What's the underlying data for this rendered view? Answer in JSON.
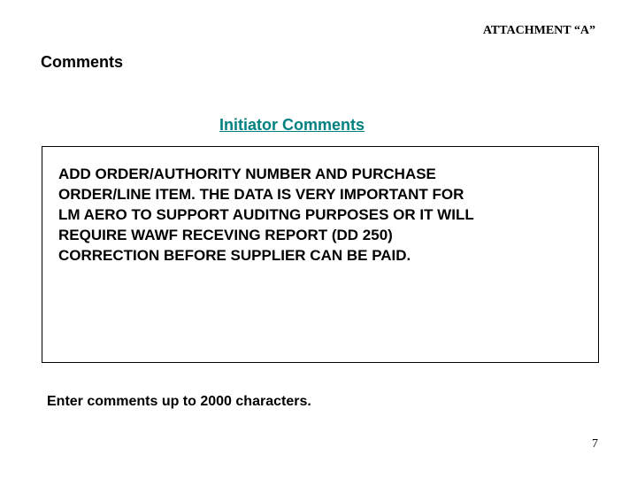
{
  "header": {
    "attachment_label": "ATTACHMENT “A”"
  },
  "headings": {
    "comments": "Comments",
    "initiator_comments": "Initiator Comments"
  },
  "comment_box": {
    "text": "ADD ORDER/AUTHORITY NUMBER AND PURCHASE ORDER/LINE ITEM. THE DATA IS VERY IMPORTANT FOR LM AERO TO SUPPORT AUDITNG PURPOSES OR IT WILL REQUIRE WAWF RECEVING REPORT (DD 250) CORRECTION BEFORE SUPPLIER CAN BE PAID."
  },
  "helper": {
    "text": "Enter comments up to 2000 characters."
  },
  "footer": {
    "page_number": "7"
  }
}
